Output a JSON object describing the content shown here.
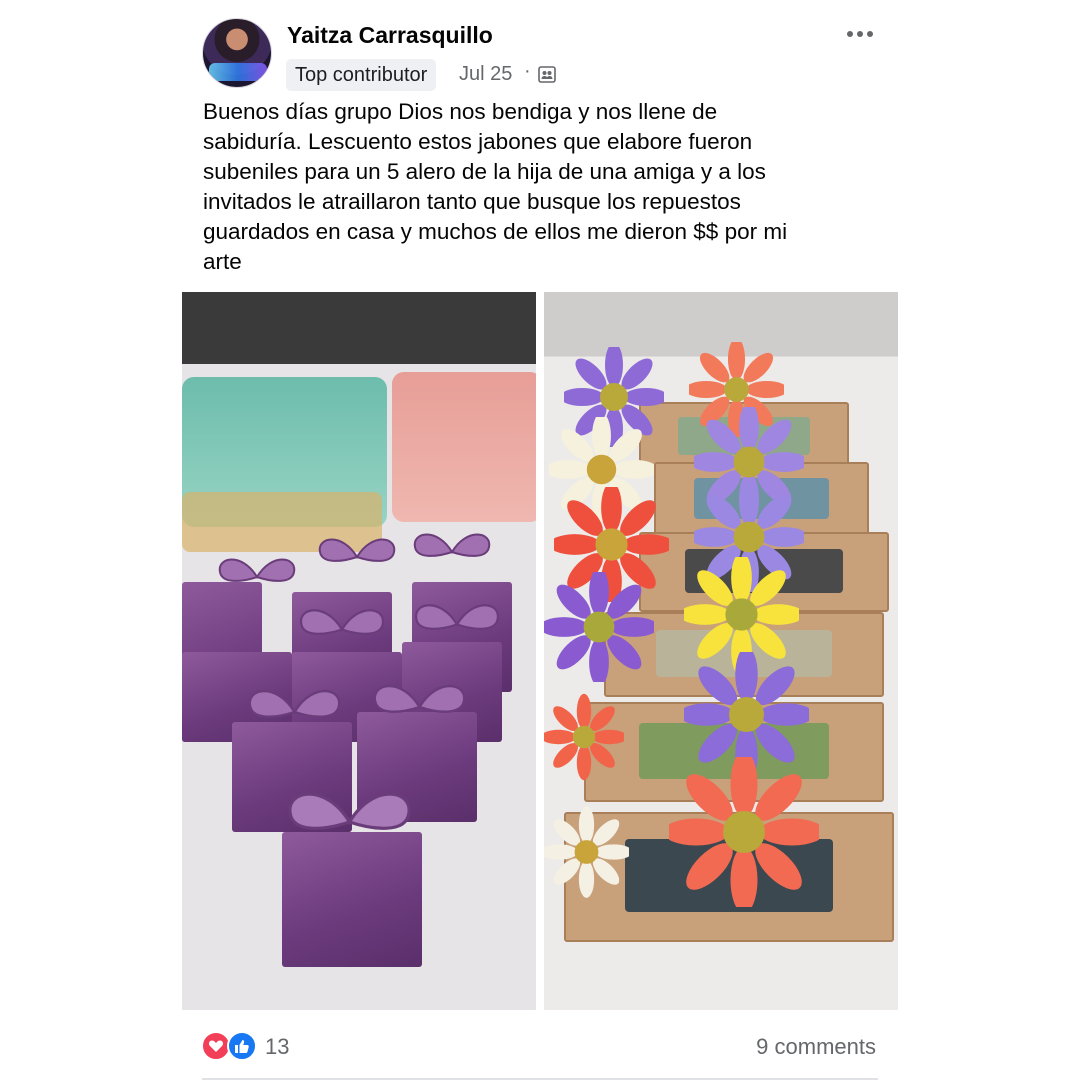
{
  "post": {
    "author": "Yaitza Carrasquillo",
    "badge": "Top contributor",
    "date": "Jul 25",
    "separator": "·",
    "audience_icon": "group-icon",
    "more_icon": "more-horizontal-icon",
    "text": "Buenos días grupo Dios nos bendiga y nos llene de\nsabiduría. Lescuento estos jabones que elabore fueron\nsubeniles para un 5 alero de la hija de una amiga y a los\ninvitados le atraillaron tanto que busque los repuestos\nguardados en casa y muchos de ellos me dieron $$ por mi\narte"
  },
  "photos": [
    {
      "name": "purple-butterfly-favor-boxes"
    },
    {
      "name": "soaps-with-daisies"
    }
  ],
  "footer": {
    "reaction_icons": [
      "love-reaction-icon",
      "like-reaction-icon"
    ],
    "reaction_count": "13",
    "comments": "9 comments"
  },
  "colors": {
    "love": "#f33e58",
    "like": "#1877f2",
    "secondary_text": "#65676b"
  }
}
